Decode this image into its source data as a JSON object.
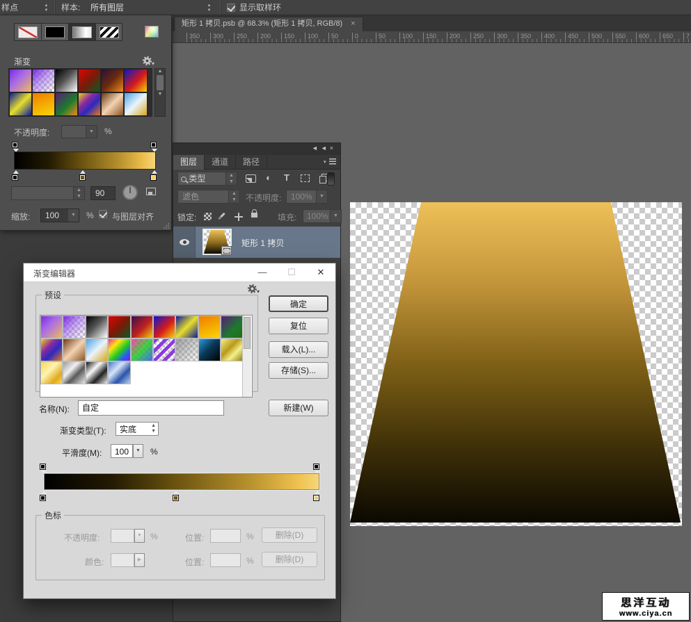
{
  "options_bar": {
    "sample_size_value": "样点",
    "sample_label": "样本:",
    "sample_value": "所有图层",
    "show_ring_label": "显示取样环",
    "show_ring_checked": true
  },
  "fill_popup": {
    "header": "渐变",
    "opacity_label": "不透明度:",
    "percent": "%",
    "angle_value": "90",
    "scale_label": "缩放:",
    "scale_value": "100",
    "align_label": "与图层对齐",
    "fill_types": [
      "none-fill",
      "solid-fill",
      "gradient-fill",
      "pattern-fill"
    ],
    "presets": [
      "linear-gradient(135deg,#7b2be0 0%,#a86ae8 40%,#edb95f 100%)",
      "linear-gradient(135deg,#7b2be0 0%,rgba(150,90,235,0.55) 45%,rgba(255,255,255,0) 100%), repeating-conic-gradient(#c8c8c8 0% 25%,#fff 0% 50%) 0 0/8px 8px",
      "linear-gradient(135deg,#000 0%,#555 45%,#fff 100%)",
      "linear-gradient(135deg,#e00404 0%,#7a1a08 50%,#0a5a20 100%)",
      "linear-gradient(135deg,#2a1038 0%,#6a2a10 50%,#ef8b1a 100%)",
      "linear-gradient(135deg,#0b16c8 0%,#d61a1a 55%,#f5d205 100%)",
      "linear-gradient(135deg,#0a1a9a 0%,#e8df2a 50%,#0a1a9a 100%)",
      "linear-gradient(160deg,#f07c00 0%,#f8d706 100%)",
      "linear-gradient(135deg,#5a1a7a 0%,#1c7a2e 55%,#ef8b1a 100%)",
      "linear-gradient(135deg,#f2cf1a 0%,#8a2aa0 35%,#2a2ac0 60%,#ef7a10 100%)",
      "linear-gradient(135deg,#6a3a16 0%,#f3d2b2 50%,#8a5524 100%)",
      "linear-gradient(135deg,#4aa2e8 0%,#eaf4fb 50%,#d9a61c 100%)"
    ]
  },
  "document": {
    "tab_title": "矩形 1 拷贝.psb @ 68.3% (矩形 1 拷贝, RGB/8)",
    "tab_close": "×",
    "ruler_labels": [
      "350",
      "300",
      "250",
      "200",
      "150",
      "100",
      "50",
      "0",
      "50",
      "100",
      "150",
      "200",
      "250",
      "300",
      "350",
      "400",
      "450",
      "500",
      "550",
      "600",
      "650",
      "7"
    ],
    "shape_gradient": "linear-gradient(180deg,#eec059 0%,#c3953a 25%,#7e6016 50%,#3e2f08 76%,#0a0701 100%)"
  },
  "layers_panel": {
    "tabs": [
      "图层",
      "通道",
      "路径"
    ],
    "filter_label": "类型",
    "blend_mode": "滤色",
    "opacity_label": "不透明度:",
    "opacity_value": "100%",
    "lock_label": "锁定:",
    "fill_label": "填充:",
    "fill_value": "100%",
    "layer_name": "矩形 1 拷贝"
  },
  "gradient_editor": {
    "title": "渐变编辑器",
    "presets_label": "预设",
    "ok": "确定",
    "reset": "复位",
    "load": "载入(L)...",
    "save": "存储(S)...",
    "new": "新建(W)",
    "name_label": "名称(N):",
    "name_value": "自定",
    "type_label": "渐变类型(T):",
    "type_value": "实底",
    "smoothness_label": "平滑度(M):",
    "smoothness_value": "100",
    "percent": "%",
    "stops_label": "色标",
    "stop_opacity_label": "不透明度:",
    "position_label": "位置:",
    "delete_label": "删除(D)",
    "color_label": "颜色:",
    "minimize": "—",
    "maximize": "☐",
    "close": "✕",
    "presets": [
      "linear-gradient(135deg,#7b2be0 0%,#a86ae8 40%,#edb95f 100%)",
      "linear-gradient(135deg,#7b2be0 0%,rgba(150,90,235,0.55) 45%,rgba(255,255,255,0) 100%), repeating-conic-gradient(#c8c8c8 0% 25%,#fff 0% 50%) 0 0/8px 8px",
      "linear-gradient(135deg,#000 0%,#555 45%,#fff 100%)",
      "linear-gradient(135deg,#e00404 0%,#7a1a08 50%,#0a5a20 100%)",
      "linear-gradient(135deg,#3a1050 0%,#c02020 55%,#f0d000 100%)",
      "linear-gradient(135deg,#0b16c8 0%,#d61a1a 55%,#f5d205 100%)",
      "linear-gradient(135deg,#0a1a9a 0%,#e8df2a 50%,#0a1a9a 100%)",
      "linear-gradient(160deg,#f07c00 0%,#f8d706 100%)",
      "linear-gradient(135deg,#5a1a7a 0%,#1c7a2e 60%,#2a6a10 100%)",
      "linear-gradient(135deg,#f2cf1a 0%,#8a2aa0 35%,#2a2ac0 60%,#ef7a10 100%)",
      "linear-gradient(135deg,#6a3a16 0%,#f3d2b2 50%,#8a5524 100%)",
      "linear-gradient(135deg,#4aa2e8 0%,#eaf4fb 50%,#d9a61c 100%)",
      "linear-gradient(135deg,#ff2aa0 0%,#ffe60a 28%,#22cc22 55%,#2a55ff 80%,#8a1ad0 100%)",
      "linear-gradient(135deg,rgba(255,42,160,0.85) 0%,rgba(34,204,34,0.85) 50%,rgba(42,85,255,0.85) 100%), repeating-conic-gradient(#c8c8c8 0% 25%,#fff 0% 50%) 0 0/8px 8px",
      "repeating-linear-gradient(135deg,#8a3ae0 0 5px,rgba(255,255,255,0) 5px 10px), repeating-conic-gradient(#c8c8c8 0% 25%,#fff 0% 50%) 0 0/8px 8px",
      "linear-gradient(135deg,rgba(130,130,130,0.75) 0%,rgba(200,200,200,0.15) 100%), repeating-conic-gradient(#c8c8c8 0% 25%,#fff 0% 50%) 0 0/8px 8px",
      "linear-gradient(135deg,#2a9ad8 0%,#0a3a5a 45%,#000 100%)",
      "linear-gradient(135deg,#f5ef8a 0%,#b89a1a 40%,#f5ef8a 65%,#8a7a10 100%)",
      "linear-gradient(135deg,#f7d75a 0%,#fdf3b0 40%,#e2a81e 75%,#f7d75a 100%)",
      "linear-gradient(135deg,#9a9a9a 0%,#f0f0f0 35%,#5a5a5a 60%,#e8e8e8 100%)",
      "linear-gradient(135deg,#111 0%,#f8f8f8 35%,#222 65%,#eee 100%)",
      "linear-gradient(135deg,#4a78c8 0%,#d6e4f8 35%,#2a55a8 65%,#bcd2f0 100%)"
    ]
  },
  "gradient": {
    "bar_css": "linear-gradient(90deg,#000 0%,#241b03 25%,#6b5410 48%,#b8922e 75%,#eec04e 92%,#f6d679 100%)",
    "opacity_stops": [
      {
        "pos": 0,
        "color": "#000000"
      },
      {
        "pos": 100,
        "color": "#000000"
      }
    ],
    "color_stops": [
      {
        "pos": 0,
        "color": "#000000"
      },
      {
        "pos": 48.5,
        "color": "#6b5410"
      },
      {
        "pos": 100,
        "color": "#f2cd6e"
      }
    ]
  },
  "watermark": {
    "line1": "思洋互动",
    "line2": "www.ciya.cn"
  },
  "colors": {
    "pasteboard": "#626262",
    "panel_dark": "#404040",
    "selected_layer": "#68778a",
    "dialog_bg": "#d8d8d8",
    "gold_top": "#eec059",
    "gold_bottom": "#0a0701"
  }
}
